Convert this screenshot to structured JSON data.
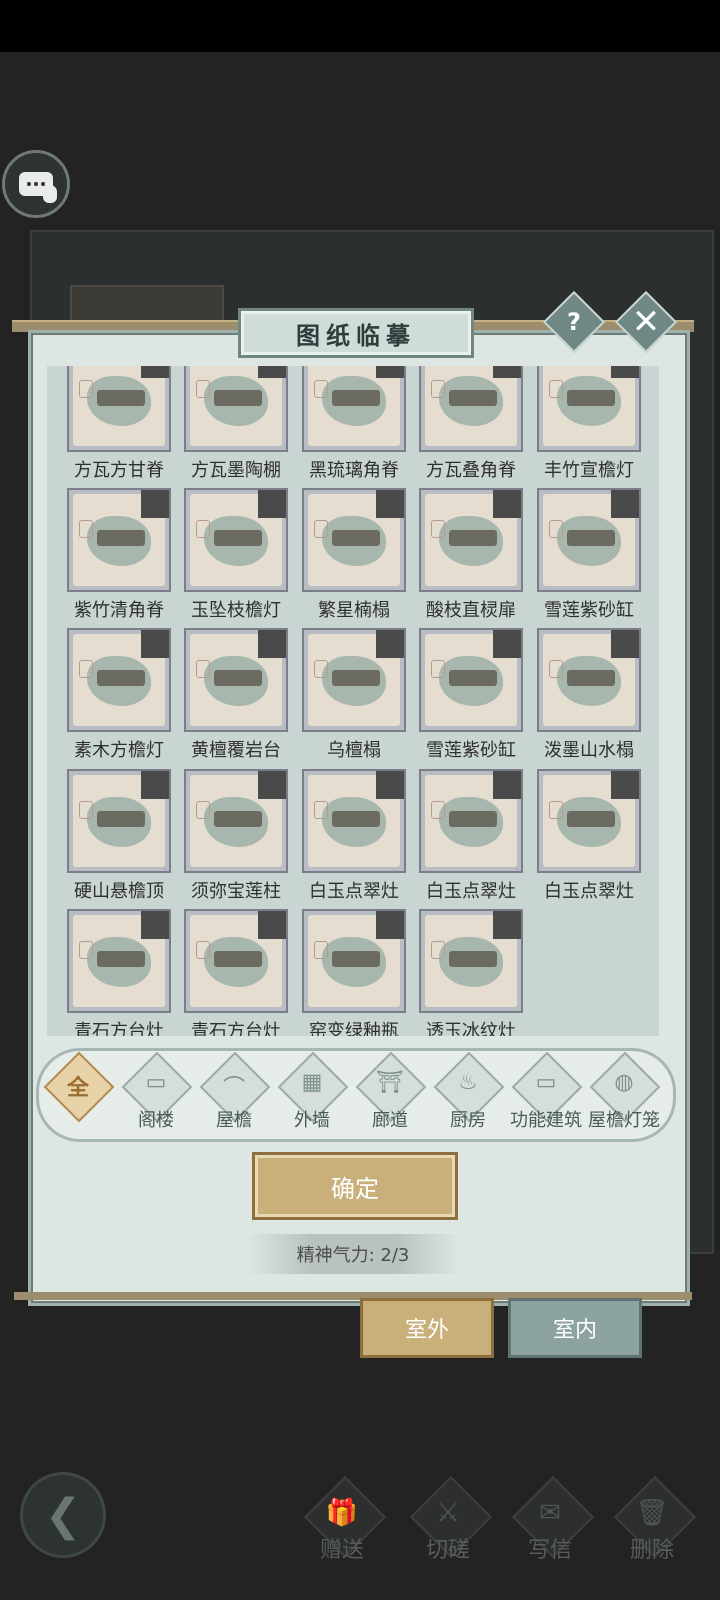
{
  "dialog": {
    "title": "图纸临摹",
    "help": "?",
    "close": "✕"
  },
  "grid": {
    "items": [
      {
        "label": "方瓦方甘脊"
      },
      {
        "label": "方瓦墨陶棚"
      },
      {
        "label": "黑琉璃角脊"
      },
      {
        "label": "方瓦叠角脊"
      },
      {
        "label": "丰竹宣檐灯"
      },
      {
        "label": "紫竹清角脊"
      },
      {
        "label": "玉坠枝檐灯"
      },
      {
        "label": "繁星楠榻"
      },
      {
        "label": "酸枝直棂扉"
      },
      {
        "label": "雪莲紫砂缸"
      },
      {
        "label": "素木方檐灯"
      },
      {
        "label": "黄檀覆岩台"
      },
      {
        "label": "乌檀榻"
      },
      {
        "label": "雪莲紫砂缸"
      },
      {
        "label": "泼墨山水榻"
      },
      {
        "label": "硬山悬檐顶"
      },
      {
        "label": "须弥宝莲柱"
      },
      {
        "label": "白玉点翠灶"
      },
      {
        "label": "白玉点翠灶"
      },
      {
        "label": "白玉点翠灶"
      },
      {
        "label": "青石方台灶"
      },
      {
        "label": "青石方台灶"
      },
      {
        "label": "窑变绿釉瓶"
      },
      {
        "label": "透玉冰纹灶"
      }
    ]
  },
  "categories": [
    {
      "label": "全部",
      "icon": "全",
      "active": true
    },
    {
      "label": "阁楼",
      "icon": "▭"
    },
    {
      "label": "屋檐",
      "icon": "⌒"
    },
    {
      "label": "外墙",
      "icon": "▦"
    },
    {
      "label": "廊道",
      "icon": "⛩"
    },
    {
      "label": "厨房",
      "icon": "♨"
    },
    {
      "label": "功能建筑",
      "icon": "▭"
    },
    {
      "label": "屋檐灯笼",
      "icon": "◍"
    }
  ],
  "confirm": "确定",
  "spirit": "精神气力: 2/3",
  "tabs": {
    "outdoor": "室外",
    "indoor": "室内"
  },
  "bottom_actions": [
    {
      "label": "赠送",
      "icon": "🎁"
    },
    {
      "label": "切磋",
      "icon": "⚔"
    },
    {
      "label": "写信",
      "icon": "✉"
    },
    {
      "label": "删除",
      "icon": "🗑"
    }
  ]
}
